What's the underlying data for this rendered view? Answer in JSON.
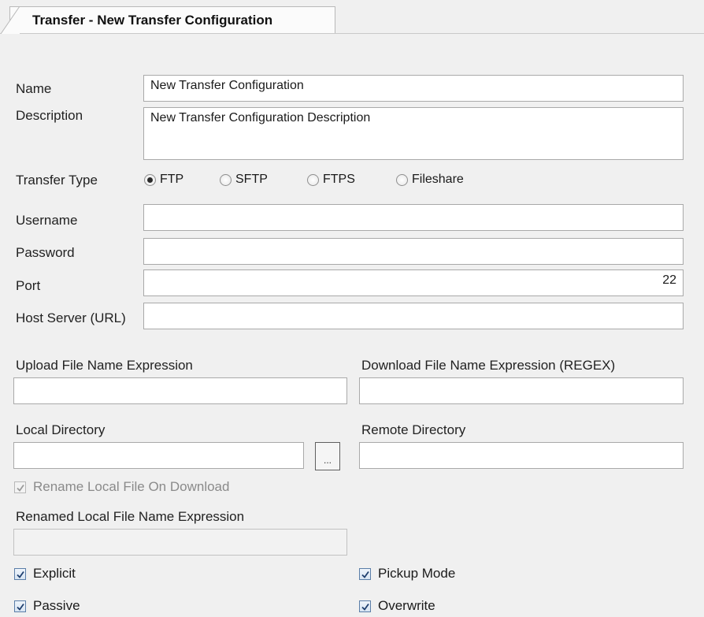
{
  "tab": {
    "title": "Transfer - New Transfer Configuration"
  },
  "form": {
    "name_label": "Name",
    "name_value": "New Transfer Configuration",
    "description_label": "Description",
    "description_value": "New Transfer Configuration Description",
    "transfer_type_label": "Transfer Type",
    "transfer_types": [
      {
        "label": "FTP",
        "selected": true
      },
      {
        "label": "SFTP",
        "selected": false
      },
      {
        "label": "FTPS",
        "selected": false
      },
      {
        "label": "Fileshare",
        "selected": false
      }
    ],
    "username_label": "Username",
    "username_value": "",
    "password_label": "Password",
    "password_value": "",
    "port_label": "Port",
    "port_value": "22",
    "host_label": "Host Server (URL)",
    "host_value": "",
    "upload_label": "Upload File Name Expression",
    "upload_value": "",
    "download_label": "Download File Name Expression (REGEX)",
    "download_value": "",
    "local_dir_label": "Local Directory",
    "local_dir_value": "",
    "browse_label": "...",
    "remote_dir_label": "Remote Directory",
    "remote_dir_value": "",
    "rename_label": "Rename Local File On Download",
    "rename_checked": true,
    "renamed_expr_label": "Renamed Local File Name Expression",
    "renamed_expr_value": "",
    "explicit_label": "Explicit",
    "explicit_checked": true,
    "passive_label": "Passive",
    "passive_checked": true,
    "pickup_label": "Pickup Mode",
    "pickup_checked": true,
    "overwrite_label": "Overwrite",
    "overwrite_checked": true
  },
  "icons": {
    "checkmark": "check-icon",
    "radio": "radio-dot-icon"
  }
}
